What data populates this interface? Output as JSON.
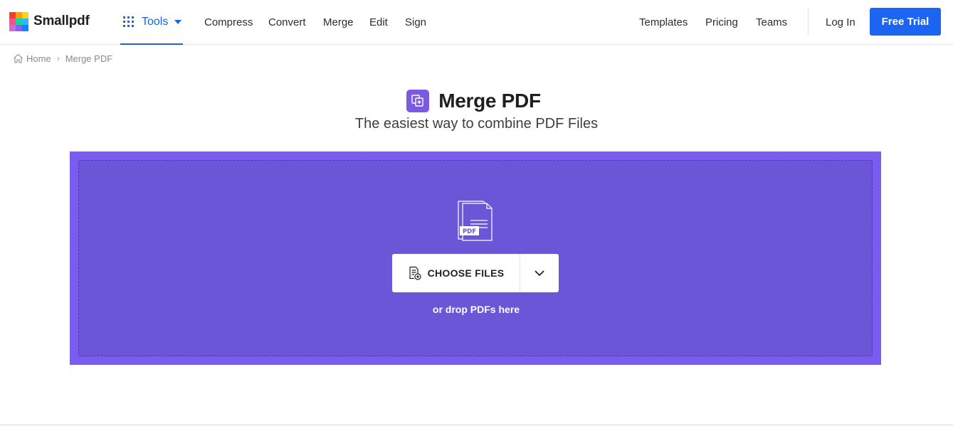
{
  "brand": {
    "name": "Smallpdf",
    "logo_colors": [
      "#ff3a2f",
      "#ff9e0b",
      "#ffd60a",
      "#1dd1a1",
      "#2eb6ff",
      "#0a84ff",
      "#c86dd7",
      "#ff4f8b",
      "#8e5cf7"
    ]
  },
  "header": {
    "tools_label": "Tools",
    "nav": [
      "Compress",
      "Convert",
      "Merge",
      "Edit",
      "Sign"
    ],
    "right_nav": [
      "Templates",
      "Pricing",
      "Teams"
    ],
    "login_label": "Log In",
    "free_trial_label": "Free Trial",
    "accent_color": "#1c64f2"
  },
  "breadcrumb": {
    "home": "Home",
    "current": "Merge PDF"
  },
  "hero": {
    "title": "Merge PDF",
    "subtitle": "The easiest way to combine PDF Files",
    "icon": "merge-icon",
    "icon_color": "#7a5ae0"
  },
  "dropzone": {
    "illustration_label": "PDF",
    "choose_label": "CHOOSE FILES",
    "drop_hint": "or drop PDFs here",
    "background_color": "#7b5cf0",
    "inner_color": "#6c56d8"
  }
}
